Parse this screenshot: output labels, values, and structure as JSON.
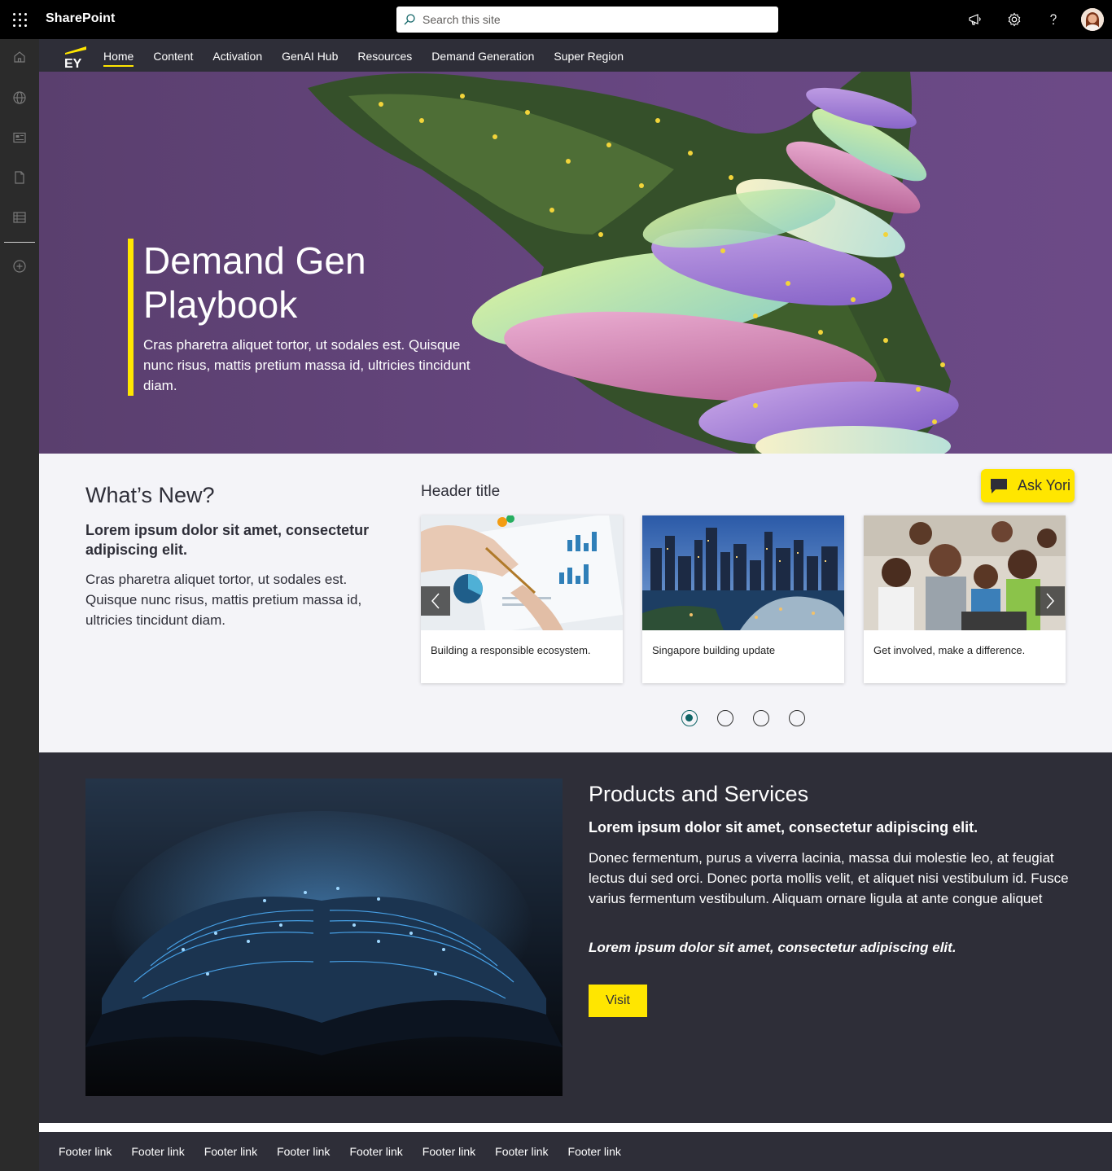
{
  "suitebar": {
    "app_name": "SharePoint",
    "search_placeholder": "Search this site"
  },
  "nav": {
    "items": [
      {
        "label": "Home",
        "active": true
      },
      {
        "label": "Content"
      },
      {
        "label": "Activation"
      },
      {
        "label": "GenAI Hub"
      },
      {
        "label": "Resources"
      },
      {
        "label": "Demand Generation"
      },
      {
        "label": "Super Region"
      }
    ]
  },
  "hero": {
    "title": "Demand Gen Playbook",
    "subtitle": "Cras pharetra aliquet tortor, ut sodales est. Quisque nunc risus, mattis pretium massa id, ultricies tincidunt diam."
  },
  "whats_new": {
    "title": "What’s New?",
    "bold": "Lorem ipsum dolor sit amet, consectetur adipiscing elit.",
    "body": "Cras pharetra aliquet tortor, ut sodales est. Quisque nunc risus, mattis pretium massa id, ultricies tincidunt diam.",
    "header_title": "Header title",
    "ask_button": "Ask Yori",
    "cards": [
      {
        "caption": "Building a responsible ecosystem."
      },
      {
        "caption": "Singapore building update"
      },
      {
        "caption": "Get involved, make a difference."
      }
    ],
    "pager": {
      "pages": 4,
      "current": 1
    }
  },
  "products": {
    "title": "Products and Services",
    "bold": "Lorem ipsum dolor sit amet, consectetur adipiscing elit.",
    "body": "Donec fermentum, purus a viverra lacinia, massa dui molestie leo, at feugiat lectus dui sed orci. Donec porta mollis velit, et aliquet nisi vestibulum id. Fusce varius fermentum vestibulum. Aliquam ornare ligula at ante congue aliquet",
    "italic": "Lorem ipsum dolor sit amet, consectetur adipiscing elit.",
    "button": "Visit"
  },
  "footer": {
    "links": [
      "Footer link",
      "Footer link",
      "Footer link",
      "Footer link",
      "Footer link",
      "Footer link",
      "Footer link",
      "Footer link"
    ]
  },
  "colors": {
    "accent": "#ffe600",
    "dark": "#2e2e38",
    "hero_bg": "#684782",
    "active_dot": "#0f6466"
  },
  "icons": {
    "suitebar": [
      "waffle-icon",
      "megaphone-icon",
      "gear-icon",
      "help-icon"
    ],
    "rail": [
      "home-icon",
      "globe-icon",
      "news-icon",
      "document-icon",
      "list-icon",
      "add-icon"
    ]
  }
}
